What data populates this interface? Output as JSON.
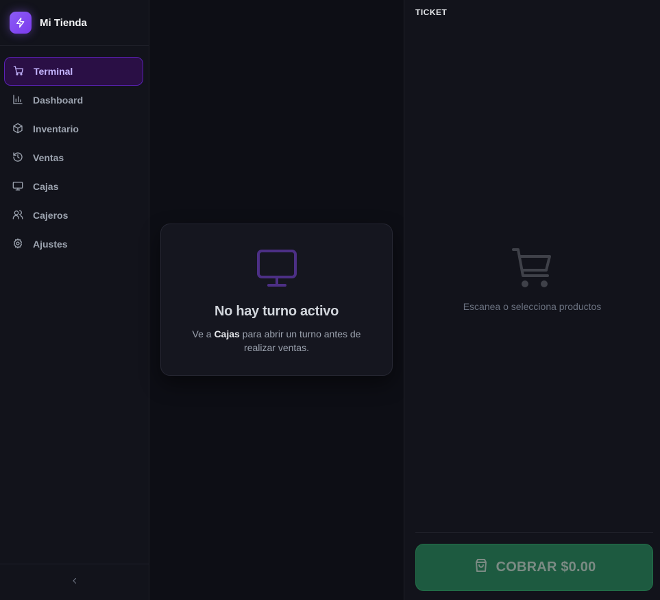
{
  "app": {
    "name": "Mi Tienda"
  },
  "sidebar": {
    "items": [
      {
        "label": "Terminal",
        "icon": "cart-icon",
        "active": true
      },
      {
        "label": "Dashboard",
        "icon": "bar-chart-icon",
        "active": false
      },
      {
        "label": "Inventario",
        "icon": "box-icon",
        "active": false
      },
      {
        "label": "Ventas",
        "icon": "history-icon",
        "active": false
      },
      {
        "label": "Cajas",
        "icon": "monitor-icon",
        "active": false
      },
      {
        "label": "Cajeros",
        "icon": "users-icon",
        "active": false
      },
      {
        "label": "Ajustes",
        "icon": "gear-icon",
        "active": false
      }
    ],
    "collapse_icon": "chevron-left-icon"
  },
  "main": {
    "empty_state": {
      "icon": "monitor-icon",
      "title": "No hay turno activo",
      "desc_prefix": "Ve a ",
      "desc_link": "Cajas",
      "desc_suffix": " para abrir un turno antes de realizar ventas."
    }
  },
  "ticket": {
    "title": "TICKET",
    "empty_icon": "cart-icon",
    "empty_text": "Escanea o selecciona productos",
    "charge_button": {
      "label": "COBRAR $0.00",
      "icon": "shopping-bag-icon"
    }
  },
  "colors": {
    "accent": "#8b5cf6",
    "active_bg": "#2a0f45",
    "charge_bg": "#1d5a40",
    "background": "#0d0e15",
    "panel": "#12131b"
  }
}
